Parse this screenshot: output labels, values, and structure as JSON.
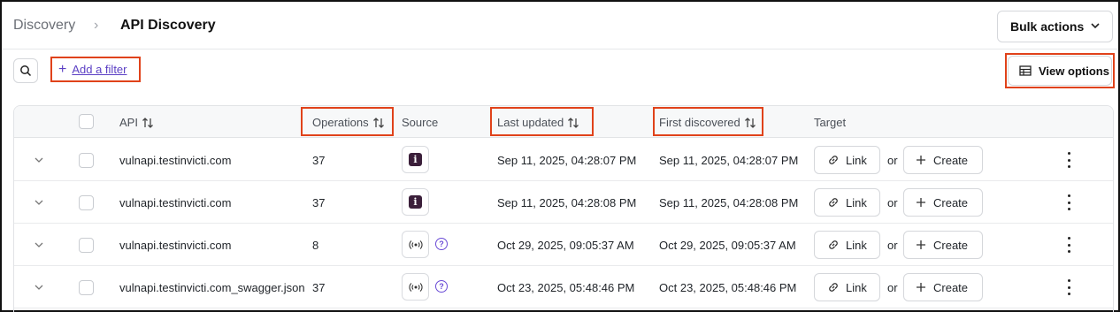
{
  "breadcrumb": {
    "parent": "Discovery",
    "separator": "›",
    "current": "API Discovery"
  },
  "toolbar": {
    "bulk_actions_label": "Bulk actions",
    "add_filter_label": "Add a filter",
    "view_options_label": "View options"
  },
  "table": {
    "columns": {
      "api": "API",
      "operations": "Operations",
      "source": "Source",
      "last_updated": "Last updated",
      "first_discovered": "First discovered",
      "target": "Target"
    },
    "link_label": "Link",
    "or_label": "or",
    "create_label": "Create",
    "rows": [
      {
        "api": "vulnapi.testinvicti.com",
        "operations": "37",
        "source_icon": "invicti-icon",
        "last_updated": "Sep 11, 2025, 04:28:07 PM",
        "first_discovered": "Sep 11, 2025, 04:28:07 PM"
      },
      {
        "api": "vulnapi.testinvicti.com",
        "operations": "37",
        "source_icon": "invicti-icon",
        "last_updated": "Sep 11, 2025, 04:28:08 PM",
        "first_discovered": "Sep 11, 2025, 04:28:08 PM"
      },
      {
        "api": "vulnapi.testinvicti.com",
        "operations": "8",
        "source_icon": "broadcast-icon",
        "last_updated": "Oct 29, 2025, 09:05:37 AM",
        "first_discovered": "Oct 29, 2025, 09:05:37 AM"
      },
      {
        "api": "vulnapi.testinvicti.com_swagger.json",
        "operations": "37",
        "source_icon": "broadcast-icon",
        "last_updated": "Oct 23, 2025, 05:48:46 PM",
        "first_discovered": "Oct 23, 2025, 05:48:46 PM"
      }
    ]
  },
  "colors": {
    "accent": "#5b3fc4",
    "highlight": "#e0421a"
  }
}
